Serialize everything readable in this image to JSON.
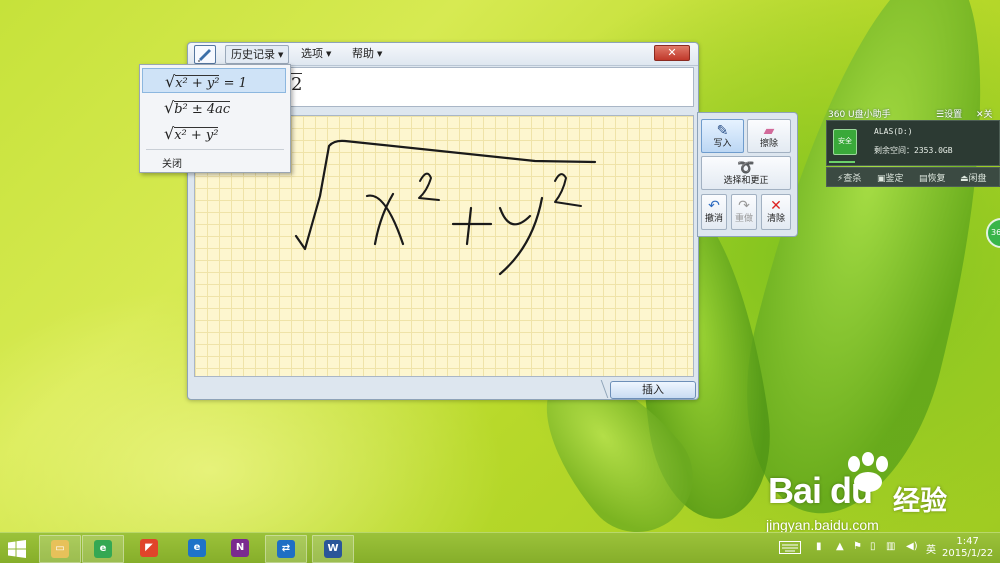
{
  "math_panel": {
    "menus": {
      "history": "历史记录",
      "options": "选项",
      "help": "帮助"
    },
    "close_glyph": "✕",
    "preview_partial": "2",
    "insert_label": "插入"
  },
  "history_dropdown": {
    "items": [
      {
        "radicand": "x² + y²",
        "rest": " = 1"
      },
      {
        "radicand": "b² ± 4ac",
        "rest": ""
      },
      {
        "radicand": "x² + y²",
        "rest": ""
      }
    ],
    "close_label": "关闭"
  },
  "tools": {
    "write": "写入",
    "erase": "擦除",
    "select_correct": "选择和更正",
    "undo": "撤消",
    "redo": "重做",
    "clear": "清除"
  },
  "usb_widget": {
    "title": "360 U盘小助手",
    "settings": "☰设置",
    "close": "✕关闭",
    "drive_icon_text": "安全",
    "drive_label": "ALAS(D:)",
    "free_space": "剩余空间：2353.0GB",
    "actions": [
      "查杀",
      "鉴定",
      "恢复",
      "闲盘"
    ],
    "badge": "360"
  },
  "watermark": {
    "brand": "Bai  du",
    "chinese": "经验",
    "url": "jingyan.baidu.com"
  },
  "taskbar": {
    "apps": [
      {
        "name": "file-explorer",
        "color": "#e7c15a",
        "glyph": "▭"
      },
      {
        "name": "ie-360",
        "color": "#34a853",
        "glyph": "e"
      },
      {
        "name": "browser-red",
        "color": "#e0442a",
        "glyph": "◤"
      },
      {
        "name": "browser-blue",
        "color": "#1e73c8",
        "glyph": "e"
      },
      {
        "name": "onenote",
        "color": "#7a2a8f",
        "glyph": "N"
      },
      {
        "name": "teamviewer",
        "color": "#1f6fc4",
        "glyph": "⇄"
      },
      {
        "name": "word",
        "color": "#2a5699",
        "glyph": "W"
      }
    ],
    "ime": "英",
    "time": "1:47",
    "date": "2015/1/22"
  },
  "colors": {
    "window_frame": "#dde6ef",
    "ink": "#1a1a1a",
    "canvas": "#fdf6cf",
    "taskbar": "#8fb630"
  }
}
